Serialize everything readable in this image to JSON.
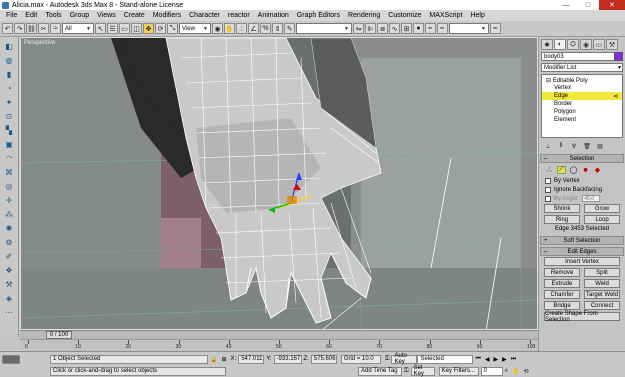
{
  "window": {
    "title": "Alicia.max - Autodesk 3ds Max 8 - Stand-alone License",
    "minimize": "—",
    "maximize": "□",
    "close": "✕"
  },
  "menu": [
    "File",
    "Edit",
    "Tools",
    "Group",
    "Views",
    "Create",
    "Modifiers",
    "Character",
    "reactor",
    "Animation",
    "Graph Editors",
    "Rendering",
    "Customize",
    "MAXScript",
    "Help"
  ],
  "toolbar": {
    "selection_filter": "All",
    "ref_coord": "View",
    "named_selection": ""
  },
  "viewport": {
    "label": "Perspective"
  },
  "timeline": {
    "frame": "0 / 100"
  },
  "ruler": {
    "ticks": [
      "0",
      "10",
      "20",
      "30",
      "40",
      "50",
      "60",
      "70",
      "80",
      "90",
      "100"
    ]
  },
  "status": {
    "selection_count": "1 Object Selected",
    "prompt": "Click or click-and-drag to select objects",
    "x_label": "X:",
    "x_value": "547.011",
    "y_label": "Y:",
    "y_value": "-933.167",
    "z_label": "Z:",
    "z_value": "575.606",
    "grid": "Grid = 10.0",
    "add_time_tag": "Add Time Tag",
    "auto_key": "Auto Key",
    "set_key": "Set Key",
    "key_mode": "Selected",
    "key_filters": "Key Filters...",
    "frame_value": "0"
  },
  "command_panel": {
    "object_name": "body03",
    "object_color": "#8a2be2",
    "modifier_list": "Modifier List",
    "stack": [
      {
        "label": "⊟ Editable Poly",
        "selected": false,
        "indent": 0
      },
      {
        "label": "Vertex",
        "selected": false,
        "indent": 1
      },
      {
        "label": "Edge",
        "selected": true,
        "indent": 1
      },
      {
        "label": "Border",
        "selected": false,
        "indent": 1
      },
      {
        "label": "Polygon",
        "selected": false,
        "indent": 1
      },
      {
        "label": "Element",
        "selected": false,
        "indent": 1
      }
    ],
    "selection_rollout": {
      "title": "Selection",
      "by_vertex": "By Vertex",
      "ignore_backfacing": "Ignore Backfacing",
      "by_angle": "By Angle:",
      "angle_value": "45.0",
      "shrink": "Shrink",
      "grow": "Grow",
      "ring": "Ring",
      "loop": "Loop",
      "info": "Edge 3453 Selected"
    },
    "soft_selection": "Soft Selection",
    "edit_edges": {
      "title": "Edit Edges",
      "insert_vertex": "Insert Vertex",
      "remove": "Remove",
      "split": "Split",
      "extrude": "Extrude",
      "weld": "Weld",
      "chamfer": "Chamfer",
      "target_weld": "Target Weld",
      "bridge": "Bridge",
      "connect": "Connect",
      "create_shape": "Create Shape From Selection"
    }
  }
}
